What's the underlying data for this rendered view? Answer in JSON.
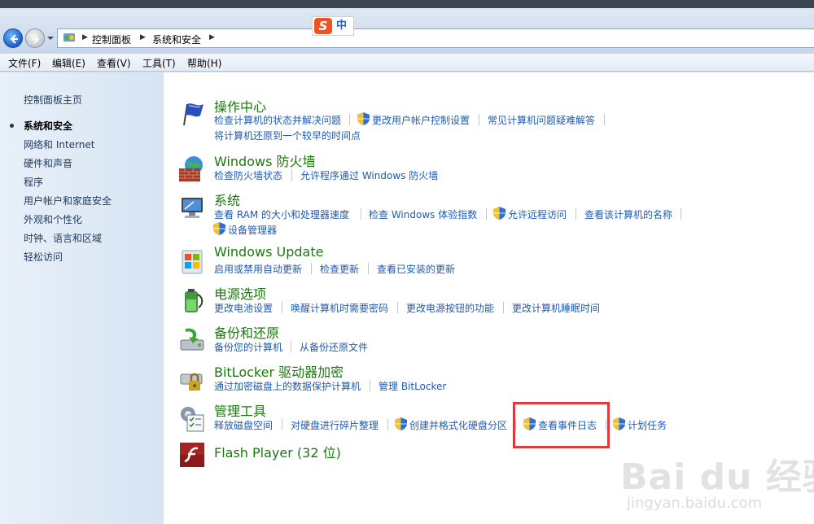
{
  "address": {
    "crumbs": [
      "控制面板",
      "系统和安全"
    ]
  },
  "ime": {
    "logo": "S",
    "mode": "中"
  },
  "menu": [
    "文件(F)",
    "编辑(E)",
    "查看(V)",
    "工具(T)",
    "帮助(H)"
  ],
  "sidebar": {
    "items": [
      {
        "label": "控制面板主页"
      },
      {
        "label": "系统和安全"
      },
      {
        "label": "网络和 Internet"
      },
      {
        "label": "硬件和声音"
      },
      {
        "label": "程序"
      },
      {
        "label": "用户帐户和家庭安全"
      },
      {
        "label": "外观和个性化"
      },
      {
        "label": "时钟、语言和区域"
      },
      {
        "label": "轻松访问"
      }
    ]
  },
  "categories": [
    {
      "title": "操作中心",
      "icon": "flag-icon",
      "row1": [
        "检查计算机的状态并解决问题",
        "更改用户帐户控制设置",
        "常见计算机问题疑难解答"
      ],
      "row2": [
        "将计算机还原到一个较早的时间点"
      ]
    },
    {
      "title": "Windows 防火墙",
      "icon": "firewall-icon",
      "row1": [
        "检查防火墙状态",
        "允许程序通过 Windows 防火墙"
      ]
    },
    {
      "title": "系统",
      "icon": "system-icon",
      "row1": [
        "查看 RAM 的大小和处理器速度",
        "检查 Windows 体验指数",
        "允许远程访问",
        "查看该计算机的名称"
      ],
      "row2": [
        "设备管理器"
      ]
    },
    {
      "title": "Windows Update",
      "icon": "windows-update-icon",
      "row1": [
        "启用或禁用自动更新",
        "检查更新",
        "查看已安装的更新"
      ]
    },
    {
      "title": "电源选项",
      "icon": "power-icon",
      "row1": [
        "更改电池设置",
        "唤醒计算机时需要密码",
        "更改电源按钮的功能",
        "更改计算机睡眠时间"
      ]
    },
    {
      "title": "备份和还原",
      "icon": "backup-icon",
      "row1": [
        "备份您的计算机",
        "从备份还原文件"
      ]
    },
    {
      "title": "BitLocker 驱动器加密",
      "icon": "bitlocker-icon",
      "row1": [
        "通过加密磁盘上的数据保护计算机",
        "管理 BitLocker"
      ]
    },
    {
      "title": "管理工具",
      "icon": "admin-tools-icon",
      "row1": [
        "释放磁盘空间",
        "对硬盘进行碎片整理",
        "创建并格式化硬盘分区",
        "查看事件日志",
        "计划任务"
      ]
    },
    {
      "title": "Flash Player (32 位)",
      "icon": "flash-player-icon"
    }
  ],
  "watermark": {
    "big": "Bai du 经验",
    "small": "jingyan.baidu.com"
  },
  "colors": {
    "title_green": "#1a7a0e",
    "link_blue": "#1e5bb5",
    "highlight": "#e0393e"
  }
}
